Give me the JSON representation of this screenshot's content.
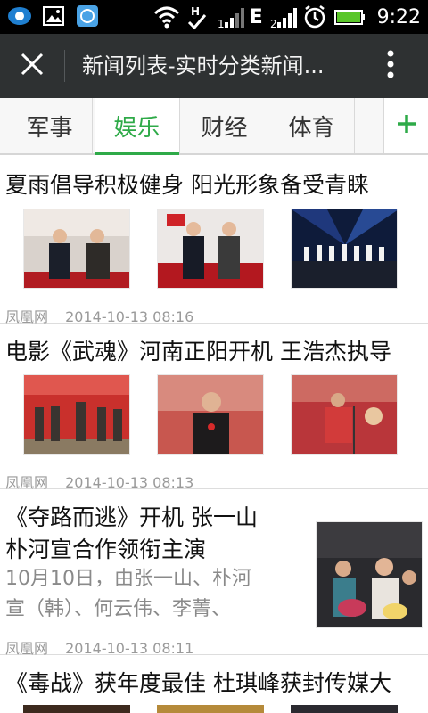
{
  "status_bar": {
    "time": "9:22",
    "network_letter": "E",
    "icons": [
      "app-icon",
      "image-icon",
      "browser-icon",
      "wifi-icon",
      "hspa-icon",
      "signal-icon",
      "data-signal-icon",
      "alarm-icon",
      "battery-icon"
    ]
  },
  "header": {
    "title": "新闻列表-实时分类新闻...",
    "close_icon": "close-icon",
    "menu_icon": "more-vert-icon"
  },
  "tabs": [
    {
      "label": "军事",
      "active": false
    },
    {
      "label": "娱乐",
      "active": true
    },
    {
      "label": "财经",
      "active": false
    },
    {
      "label": "体育",
      "active": false
    },
    {
      "label": "",
      "active": false
    }
  ],
  "add_tab_label": "+",
  "accent_color": "#2eaa48",
  "news": [
    {
      "title": "夏雨倡导积极健身 阳光形象备受青睐",
      "source": "凤凰网",
      "time": "2014-10-13 08:16"
    },
    {
      "title": "电影《武魂》河南正阳开机 王浩杰执导",
      "source": "凤凰网",
      "time": "2014-10-13 08:13"
    },
    {
      "title_line1": "《夺路而逃》开机 张一山",
      "title_line2": "朴河宣合作领衔主演",
      "summary_line1": "10月10日，由张一山、朴河",
      "summary_line2": "宣（韩）、何云伟、李菁、",
      "source": "凤凰网",
      "time": "2014-10-13 08:11"
    },
    {
      "title": "《毒战》获年度最佳 杜琪峰获封传媒大"
    }
  ]
}
